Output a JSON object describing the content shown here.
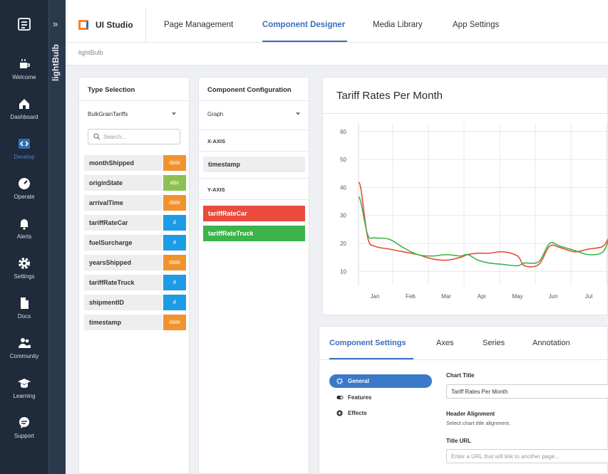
{
  "nav": {
    "items": [
      {
        "label": "Welcome",
        "icon": "coffee-icon"
      },
      {
        "label": "Dashboard",
        "icon": "home-icon"
      },
      {
        "label": "Develop",
        "icon": "code-icon"
      },
      {
        "label": "Operate",
        "icon": "gauge-icon"
      },
      {
        "label": "Alerts",
        "icon": "bell-icon"
      },
      {
        "label": "Settings",
        "icon": "gear-icon"
      },
      {
        "label": "Docs",
        "icon": "document-icon"
      },
      {
        "label": "Community",
        "icon": "users-icon"
      },
      {
        "label": "Learning",
        "icon": "graduation-cap-icon"
      },
      {
        "label": "Support",
        "icon": "chat-bubble-icon"
      }
    ],
    "active": "Develop"
  },
  "project": {
    "name": "lightBulb",
    "expand_glyph": "»"
  },
  "topbar": {
    "brand": "UI Studio",
    "tabs": [
      "Page Management",
      "Component Designer",
      "Media Library",
      "App Settings"
    ],
    "active_tab": "Component Designer"
  },
  "breadcrumb": "lightBulb",
  "type_selection": {
    "title": "Type Selection",
    "dataset": "BulkGrainTariffs",
    "search_placeholder": "Search...",
    "fields": [
      {
        "name": "monthShipped",
        "type": "date"
      },
      {
        "name": "originState",
        "type": "abc"
      },
      {
        "name": "arrivalTime",
        "type": "date"
      },
      {
        "name": "tariffRateCar",
        "type": "#"
      },
      {
        "name": "fuelSurcharge",
        "type": "#"
      },
      {
        "name": "yearsShipped",
        "type": "date"
      },
      {
        "name": "tariffRateTruck",
        "type": "#"
      },
      {
        "name": "shipmentID",
        "type": "#"
      },
      {
        "name": "timestamp",
        "type": "date"
      }
    ],
    "type_colors": {
      "date": "#f0922e",
      "abc": "#8cc152",
      "#": "#1e9be6"
    }
  },
  "component_configuration": {
    "title": "Component Configuration",
    "component_type": "Graph",
    "x_axis_label": "X-AXIS",
    "x_axis_field": "timestamp",
    "y_axis_label": "Y-AXIS",
    "y_axis_fields": [
      "tariffRateCar",
      "tariffRateTruck"
    ]
  },
  "chart_data": {
    "type": "line",
    "title": "Tariff Rates Per Month",
    "x": [
      "Jan",
      "Feb",
      "Mar",
      "Apr",
      "May",
      "Jun",
      "Jul"
    ],
    "ylim": [
      5,
      63
    ],
    "yticks": [
      10,
      20,
      30,
      40,
      50,
      60
    ],
    "grid": true,
    "series": [
      {
        "color": "#e94b3c",
        "points": [
          [
            -0.5,
            41.5
          ],
          [
            -0.4,
            40
          ],
          [
            -0.2,
            22
          ],
          [
            0,
            19
          ],
          [
            0.4,
            18
          ],
          [
            0.8,
            17
          ],
          [
            1.2,
            16
          ],
          [
            1.6,
            14.5
          ],
          [
            2.0,
            14
          ],
          [
            2.4,
            15
          ],
          [
            2.6,
            16
          ],
          [
            2.9,
            16.5
          ],
          [
            3.2,
            16.5
          ],
          [
            3.6,
            17
          ],
          [
            4.0,
            15.5
          ],
          [
            4.2,
            12
          ],
          [
            4.6,
            12.5
          ],
          [
            4.9,
            19
          ],
          [
            5.2,
            18.5
          ],
          [
            5.6,
            17
          ],
          [
            6.0,
            18
          ],
          [
            6.4,
            19
          ],
          [
            6.6,
            23
          ]
        ]
      },
      {
        "color": "#3cb44a",
        "points": [
          [
            -0.5,
            37
          ],
          [
            -0.4,
            35
          ],
          [
            -0.2,
            23
          ],
          [
            0,
            22
          ],
          [
            0.4,
            21.5
          ],
          [
            0.8,
            18.5
          ],
          [
            1.2,
            16
          ],
          [
            1.6,
            15.5
          ],
          [
            2.0,
            16
          ],
          [
            2.4,
            15.5
          ],
          [
            2.6,
            16
          ],
          [
            2.9,
            14
          ],
          [
            3.2,
            13
          ],
          [
            3.6,
            12.5
          ],
          [
            4.0,
            12
          ],
          [
            4.2,
            13
          ],
          [
            4.6,
            13.5
          ],
          [
            4.9,
            20
          ],
          [
            5.2,
            19
          ],
          [
            5.6,
            17.5
          ],
          [
            6.0,
            16
          ],
          [
            6.4,
            17
          ],
          [
            6.6,
            23
          ]
        ]
      }
    ]
  },
  "component_settings": {
    "tabs": [
      "Component Settings",
      "Axes",
      "Series",
      "Annotation"
    ],
    "active_tab": "Component Settings",
    "subnav": [
      {
        "label": "General",
        "icon": "gear-icon"
      },
      {
        "label": "Features",
        "icon": "toggle-icon"
      },
      {
        "label": "Effects",
        "icon": "plus-circle-icon"
      }
    ],
    "chart_title_label": "Chart Title",
    "chart_title_value": "Tariff Rates Per Month",
    "header_alignment_label": "Header Alignment",
    "header_alignment_help": "Select chart title alignment.",
    "title_url_label": "Title URL",
    "title_url_placeholder": "Enter a URL that will link to another page..."
  },
  "colors": {
    "nav_bg": "#1f2a3a",
    "accent": "#3a6cc0",
    "brand_orange": "#f0872e"
  }
}
